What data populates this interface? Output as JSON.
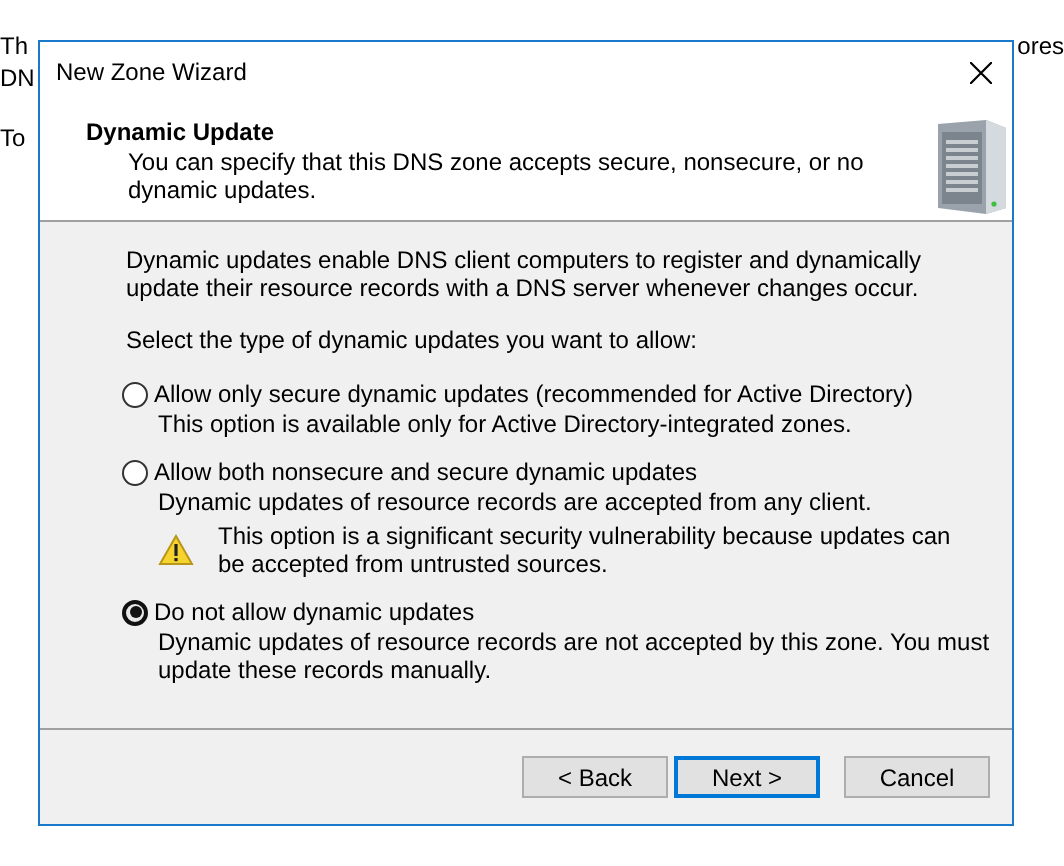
{
  "background_text": [
    {
      "left": "Th",
      "right": "ores"
    },
    {
      "left": "DN"
    },
    {
      "left": "To"
    }
  ],
  "window": {
    "title": "New Zone Wizard"
  },
  "header": {
    "title": "Dynamic Update",
    "subtitle": "You can specify that this DNS zone accepts secure, nonsecure, or no dynamic updates."
  },
  "intro": "Dynamic updates enable DNS client computers to register and dynamically update their resource records with a DNS server whenever changes occur.",
  "prompt": "Select the type of dynamic updates you want to allow:",
  "options": [
    {
      "label": "Allow only secure dynamic updates (recommended for Active Directory)",
      "description": "This option is available only for Active Directory-integrated zones.",
      "selected": false
    },
    {
      "label": "Allow both nonsecure and secure dynamic updates",
      "description": "Dynamic updates of resource records are accepted from any client.",
      "warning": "This option is a significant security vulnerability because updates can be accepted from untrusted sources.",
      "selected": false
    },
    {
      "label": "Do not allow dynamic updates",
      "description": "Dynamic updates of resource records are not accepted by this zone. You must update these records manually.",
      "selected": true
    }
  ],
  "buttons": [
    {
      "label": "< Back",
      "default": false
    },
    {
      "label": "Next >",
      "default": true
    },
    {
      "label": "Cancel",
      "default": false
    }
  ]
}
